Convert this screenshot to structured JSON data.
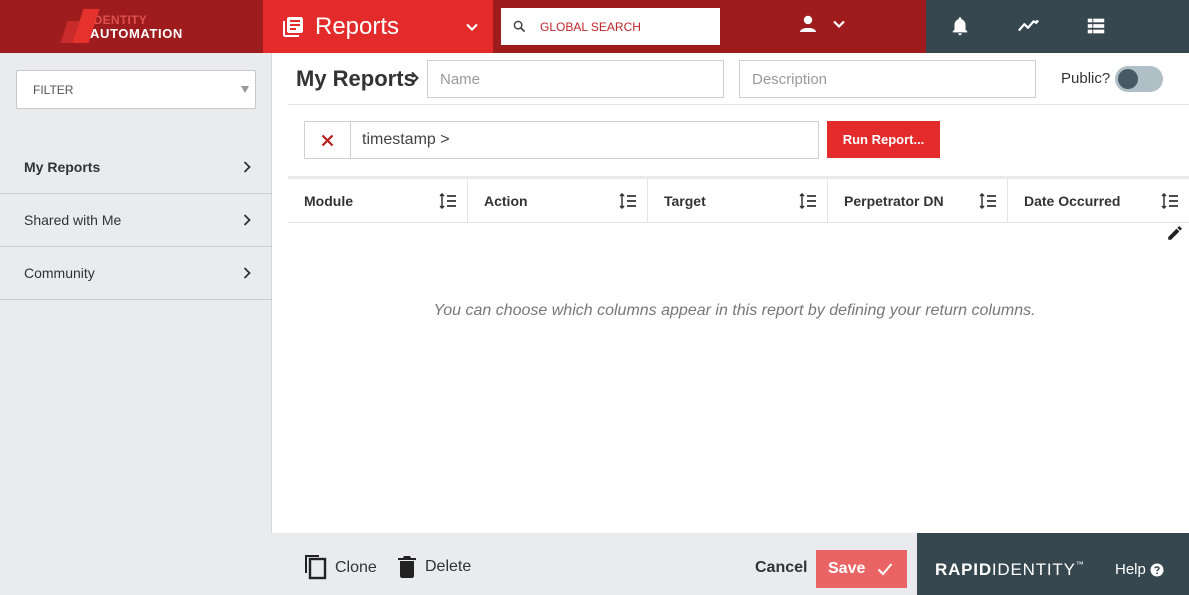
{
  "brand": {
    "line1": "IDENTITY",
    "line2": "AUTOMATION"
  },
  "module": {
    "label": "Reports",
    "icon": "reports-icon"
  },
  "search": {
    "placeholder": "GLOBAL SEARCH"
  },
  "sidebar": {
    "filter_label": "FILTER",
    "items": [
      {
        "label": "My Reports"
      },
      {
        "label": "Shared with Me"
      },
      {
        "label": "Community"
      }
    ]
  },
  "main": {
    "title": "My Reports",
    "name_placeholder": "Name",
    "description_placeholder": "Description",
    "public_label": "Public?",
    "public_enabled": false,
    "query_value": "timestamp >",
    "run_label": "Run Report...",
    "columns": [
      {
        "label": "Module"
      },
      {
        "label": "Action"
      },
      {
        "label": "Target"
      },
      {
        "label": "Perpetrator DN"
      },
      {
        "label": "Date Occurred"
      }
    ],
    "empty_message": "You can choose which columns appear in this report by defining your return columns."
  },
  "footer": {
    "clone_label": "Clone",
    "delete_label": "Delete",
    "cancel_label": "Cancel",
    "save_label": "Save",
    "brand_bold": "RAPID",
    "brand_rest": "IDENTITY",
    "brand_tm": "™",
    "help_label": "Help"
  },
  "colors": {
    "brand_red": "#e32b2b",
    "dark_red": "#9e1b1e",
    "slate": "#37474f"
  }
}
